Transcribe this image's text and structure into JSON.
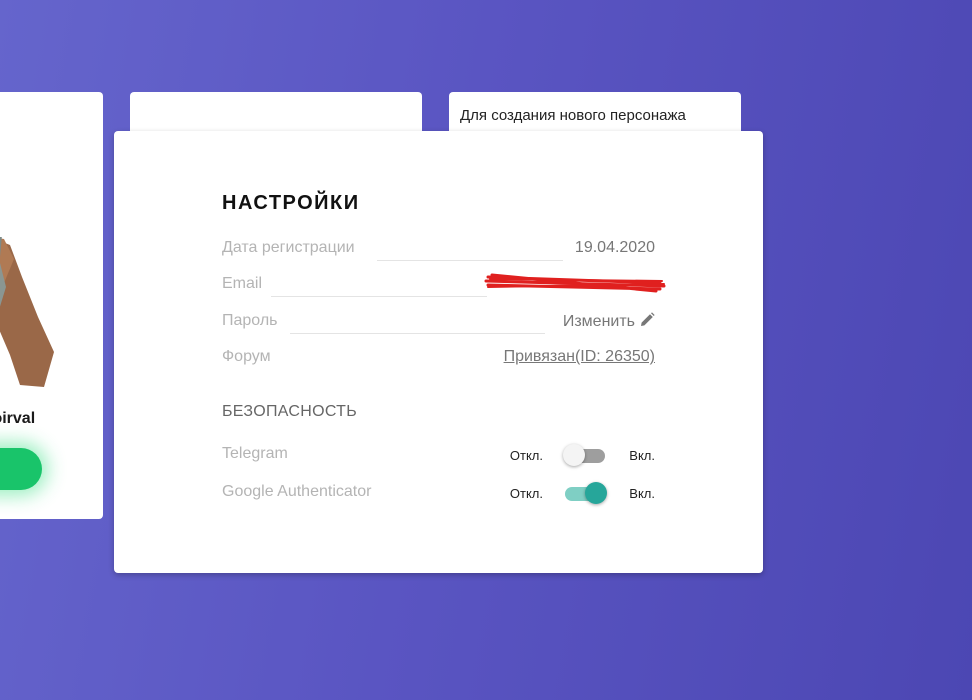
{
  "left_card": {
    "character_name": "loirval"
  },
  "right_card": {
    "text": "Для создания нового персонажа"
  },
  "settings": {
    "title": "НАСТРОЙКИ",
    "rows": [
      {
        "label": "Дата регистрации",
        "value": "19.04.2020"
      },
      {
        "label": "Email",
        "value": ""
      },
      {
        "label": "Пароль",
        "value": "Изменить"
      },
      {
        "label": "Форум",
        "value": "Привязан(ID: 26350)"
      }
    ],
    "security": {
      "title": "БЕЗОПАСНОСТЬ",
      "off_label": "Откл.",
      "on_label": "Вкл.",
      "toggles": [
        {
          "label": "Telegram",
          "enabled": false
        },
        {
          "label": "Google Authenticator",
          "enabled": true
        }
      ]
    }
  },
  "colors": {
    "toggle_on": "#26a69a",
    "toggle_off": "#9e9e9e",
    "play_button": "#19c46a",
    "redaction": "#e0201f"
  },
  "icons": [
    "pencil-icon"
  ]
}
